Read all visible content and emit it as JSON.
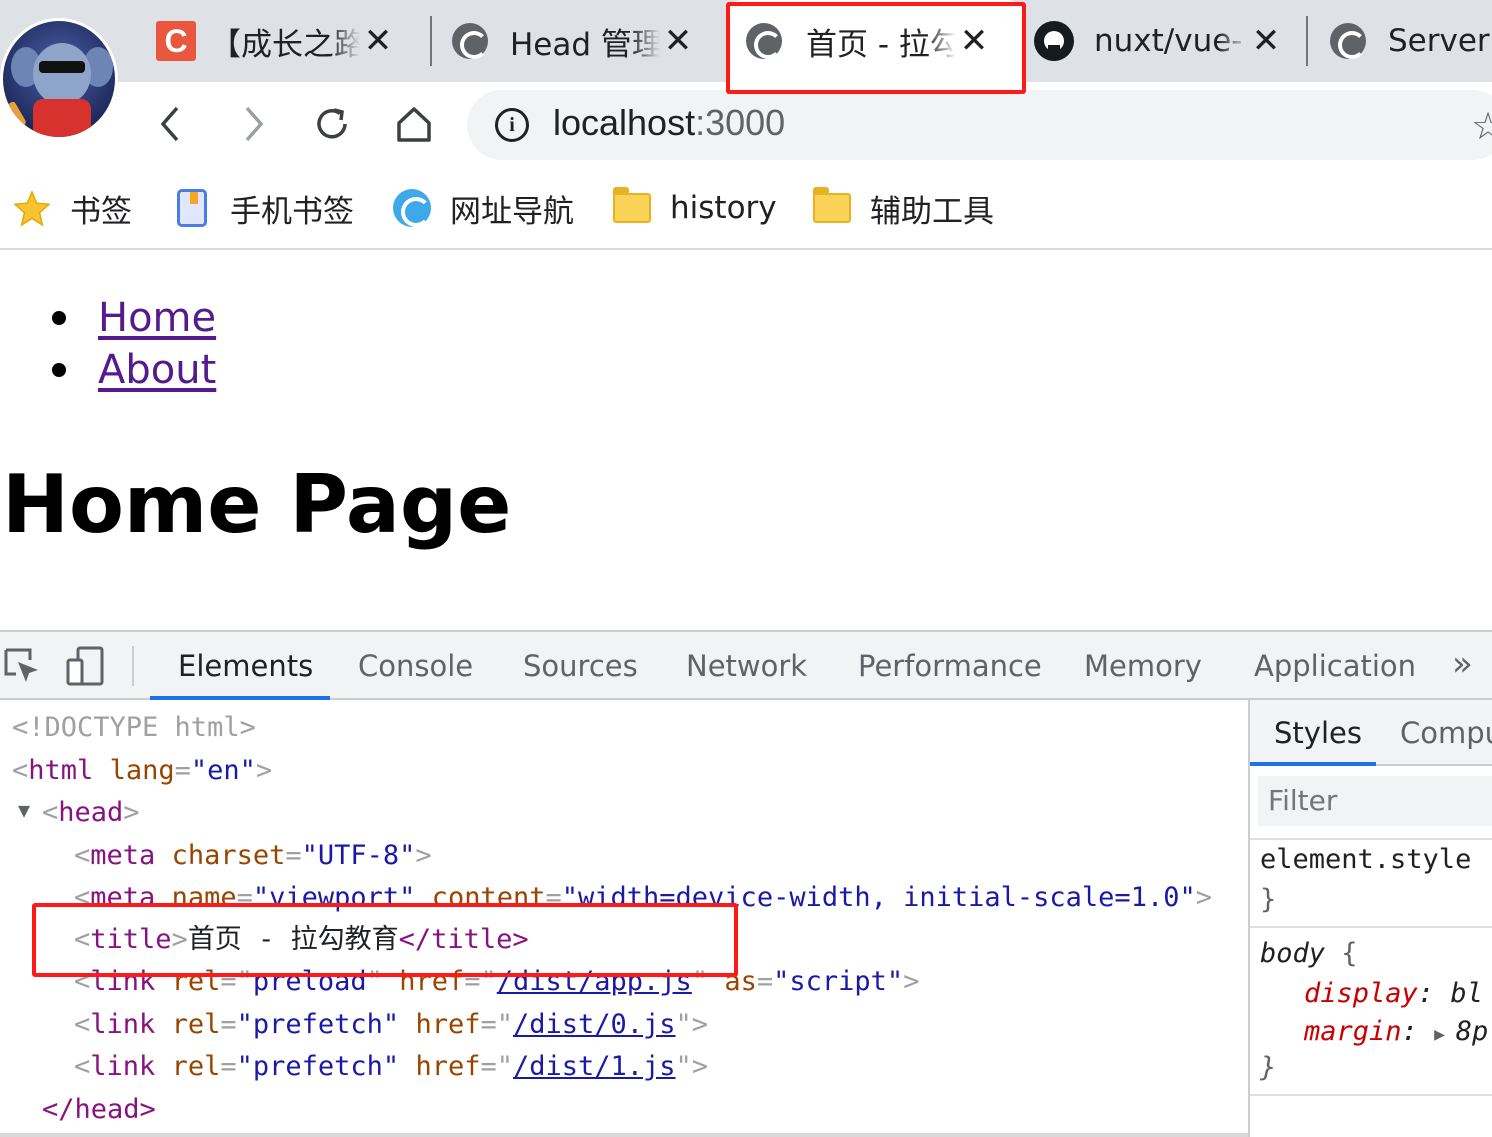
{
  "browser": {
    "tabs": [
      {
        "title": "【成长之路",
        "icon": "csdn-icon"
      },
      {
        "title": "Head 管理",
        "icon": "edge-icon"
      },
      {
        "title": "首页 - 拉勾",
        "icon": "edge-icon",
        "active": true
      },
      {
        "title": "nuxt/vue-",
        "icon": "github-icon"
      },
      {
        "title": "Server S",
        "icon": "edge-icon"
      }
    ],
    "close_glyph": "✕",
    "address": {
      "host": "localhost",
      "port": ":3000"
    },
    "bookmarks": [
      {
        "label": "书签",
        "icon": "star-icon"
      },
      {
        "label": "手机书签",
        "icon": "mobile-bookmark-icon"
      },
      {
        "label": "网址导航",
        "icon": "edge-icon"
      },
      {
        "label": "history",
        "icon": "folder-icon"
      },
      {
        "label": "辅助工具",
        "icon": "folder-icon"
      }
    ]
  },
  "page": {
    "nav": [
      "Home",
      "About"
    ],
    "heading": "Home Page"
  },
  "devtools": {
    "tabs": [
      "Elements",
      "Console",
      "Sources",
      "Network",
      "Performance",
      "Memory",
      "Application"
    ],
    "more": "»",
    "dom": {
      "doctype": "<!DOCTYPE html>",
      "html_tag": "html",
      "lang_attr": "lang",
      "lang_val": "\"en\"",
      "head_tag": "head",
      "meta_charset": {
        "tag": "meta",
        "attr": "charset",
        "val": "\"UTF-8\""
      },
      "meta_viewport": {
        "tag": "meta",
        "attr1": "name",
        "val1": "\"viewport\"",
        "attr2": "content",
        "val2": "\"width=device-width, initial-scale=1.0\""
      },
      "title": {
        "tag": "title",
        "text": "首页 - 拉勾教育",
        "close": "</title>"
      },
      "preload": {
        "tag": "link",
        "attr1": "rel",
        "val1": "preload",
        "attr2": "href",
        "val2": "/dist/app.js",
        "attr3": "as",
        "val3": "\"script\""
      },
      "prefetch": [
        {
          "tag": "link",
          "attr1": "rel",
          "val1": "\"prefetch\"",
          "attr2": "href",
          "val2": "/dist/0.js"
        },
        {
          "tag": "link",
          "attr1": "rel",
          "val1": "\"prefetch\"",
          "attr2": "href",
          "val2": "/dist/1.js"
        }
      ],
      "head_close": "</head>"
    },
    "styles": {
      "tabs": [
        "Styles",
        "Compu"
      ],
      "filter_placeholder": "Filter",
      "element_style": "element.style",
      "rule_selector": "body",
      "props": [
        {
          "name": "display",
          "value": "bl"
        },
        {
          "name": "margin",
          "value": "8p"
        }
      ]
    }
  }
}
